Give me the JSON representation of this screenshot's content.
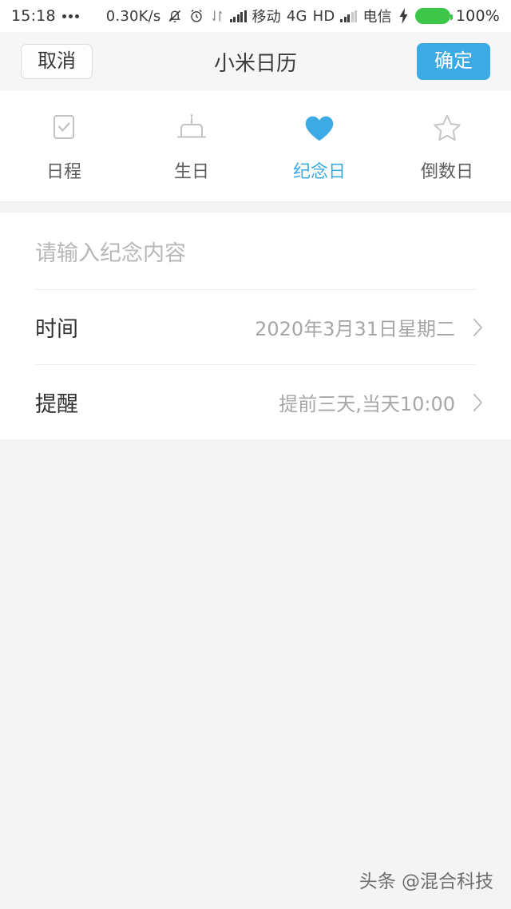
{
  "status_bar": {
    "time": "15:18",
    "overflow_icon": "more-dots-icon",
    "network_speed": "0.30K/s",
    "icons": [
      "mute-bell-icon",
      "alarm-clock-icon",
      "data-transfer-icon",
      "signal-bars-icon"
    ],
    "carrier_1": "移动",
    "network_type": "4G",
    "hd_label": "HD",
    "carrier_2": "电信",
    "charging_icon": "lightning-bolt-icon",
    "battery_icon": "battery-full-icon",
    "battery_percent": "100%"
  },
  "header": {
    "cancel_label": "取消",
    "title": "小米日历",
    "confirm_label": "确定",
    "accent_color": "#3caae4"
  },
  "tabs": [
    {
      "label": "日程",
      "icon": "checkbox-check-icon",
      "active": false
    },
    {
      "label": "生日",
      "icon": "birthday-cake-icon",
      "active": false
    },
    {
      "label": "纪念日",
      "icon": "heart-filled-icon",
      "active": true
    },
    {
      "label": "倒数日",
      "icon": "star-outline-icon",
      "active": false
    }
  ],
  "form": {
    "note_placeholder": "请输入纪念内容",
    "note_value": "",
    "rows": [
      {
        "label": "时间",
        "value": "2020年3月31日星期二",
        "chevron": "chevron-right-icon"
      },
      {
        "label": "提醒",
        "value": "提前三天,当天10:00",
        "chevron": "chevron-right-icon"
      }
    ]
  },
  "watermark": {
    "text": "头条 @混合科技"
  }
}
